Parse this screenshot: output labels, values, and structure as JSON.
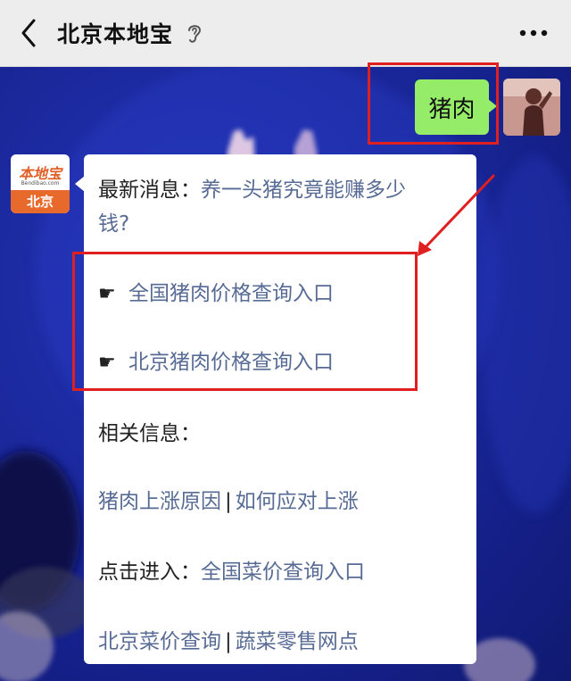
{
  "nav": {
    "title": "北京本地宝",
    "back_icon": "back-chevron-icon",
    "ear_icon": "ear-icon",
    "more_icon": "more-dots-icon"
  },
  "self_message": {
    "text": "猪肉"
  },
  "account_avatar": {
    "logo_text": "本地宝",
    "domain": "Bendibao.com",
    "city": "北京"
  },
  "reply": {
    "latest_label": "最新消息：",
    "latest_link_line1": "养一头猪究竟能赚多少",
    "latest_link_line2": "钱?",
    "hand_glyph": "☛",
    "link_national_pork": "全国猪肉价格查询入口",
    "link_beijing_pork": "北京猪肉价格查询入口",
    "related_label": "相关信息：",
    "link_pork_rise_reason": "猪肉上涨原因",
    "separator": "|",
    "link_how_to_cope": "如何应对上涨",
    "click_enter_label": "点击进入：",
    "link_national_veg": "全国菜价查询入口",
    "link_beijing_veg": "北京菜价查询",
    "link_veg_retail": "蔬菜零售网点"
  },
  "colors": {
    "annotation_red": "#e02020",
    "link_blue": "#576b95",
    "self_bubble_green": "#95ec69",
    "nav_bg": "#ededed",
    "chat_bg_blue": "#1a2690"
  }
}
